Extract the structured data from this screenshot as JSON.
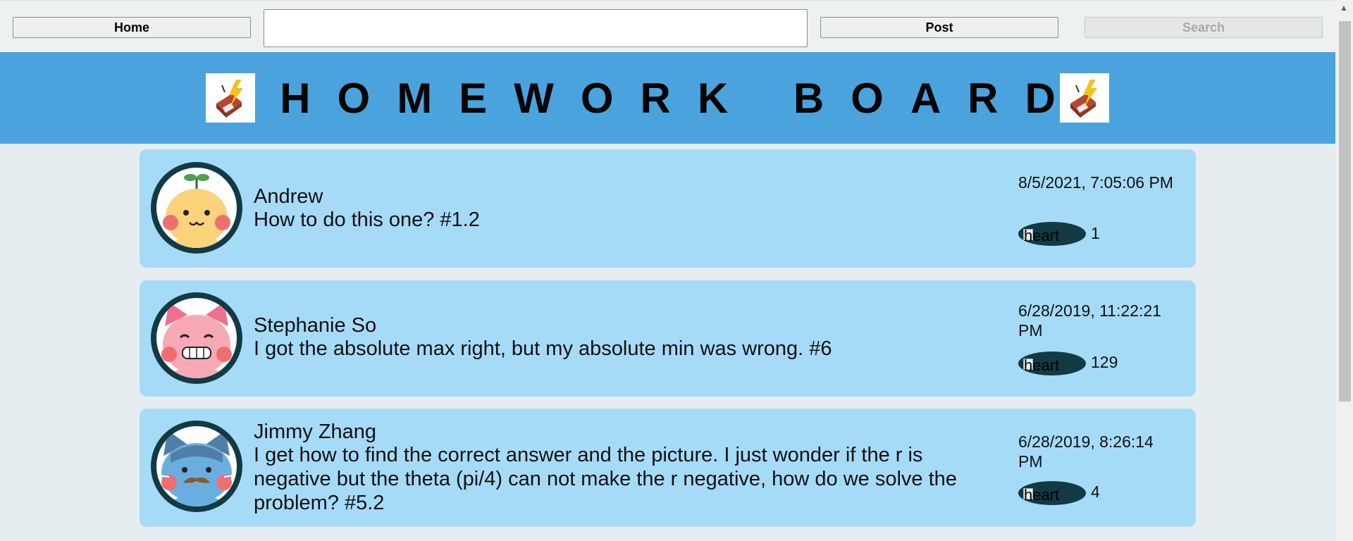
{
  "nav": {
    "home_label": "Home",
    "search_value": "",
    "post_label": "Post",
    "search_label": "Search"
  },
  "banner": {
    "title": "HOMEWORK BOARD",
    "logo_left_icon": "notebook-lightning-icon",
    "logo_right_icon": "notebook-lightning-icon"
  },
  "posts": [
    {
      "author": "Andrew",
      "content": "How to do this one? #1.2",
      "date": "8/5/2021, 7:05:06 PM",
      "heart_alt": "heart",
      "likes": "1",
      "avatar": "sprout-chick-avatar"
    },
    {
      "author": "Stephanie So",
      "content": "I got the absolute max right, but my absolute min was wrong. #6",
      "date": "6/28/2019, 11:22:21 PM",
      "heart_alt": "heart",
      "likes": "129",
      "avatar": "pink-pig-avatar"
    },
    {
      "author": "Jimmy Zhang",
      "content": "I get how to find the correct answer and the picture. I just wonder if the r is negative but the theta (pi/4) can not make the r negative, how do we solve the problem? #5.2",
      "date": "6/28/2019, 8:26:14 PM",
      "heart_alt": "heart",
      "likes": "4",
      "avatar": "blue-cat-mustache-avatar"
    }
  ],
  "colors": {
    "banner": "#4aa3dd",
    "card": "#a6dbf8",
    "page": "#e6edf0",
    "avatar_ring": "#123a44"
  }
}
